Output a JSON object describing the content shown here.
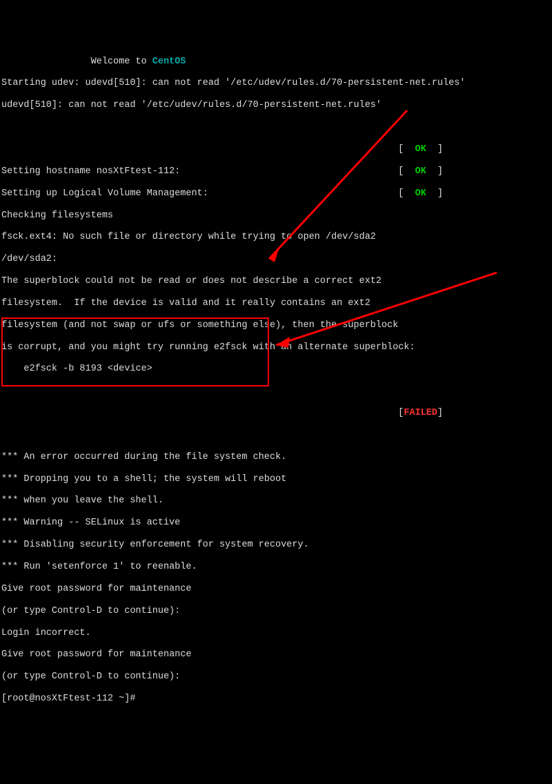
{
  "welcome_prefix": "                Welcome to ",
  "welcome_os": "CentOS",
  "boot": {
    "line1": "Starting udev: udevd[510]: can not read '/etc/udev/rules.d/70-persistent-net.rules'",
    "line2": "udevd[510]: can not read '/etc/udev/rules.d/70-persistent-net.rules'"
  },
  "status_rows": [
    {
      "label": "",
      "ok": "OK"
    },
    {
      "label": "Setting hostname nosXtFtest-112:",
      "ok": "OK"
    },
    {
      "label": "Setting up Logical Volume Management:",
      "ok": "OK"
    }
  ],
  "check_fs": "Checking filesystems",
  "fsck": {
    "l1": "fsck.ext4: No such file or directory while trying to open /dev/sda2",
    "l2": "/dev/sda2:",
    "l3": "The superblock could not be read or does not describe a correct ext2",
    "l4": "filesystem.  If the device is valid and it really contains an ext2",
    "l5": "filesystem (and not swap or ufs or something else), then the superblock",
    "l6": "is corrupt, and you might try running e2fsck with an alternate superblock:",
    "l7": "    e2fsck -b 8193 <device>"
  },
  "failed": "FAILED",
  "errors": {
    "e1": "*** An error occurred during the file system check.",
    "e2": "*** Dropping you to a shell; the system will reboot",
    "e3": "*** when you leave the shell.",
    "e4": "*** Warning -- SELinux is active",
    "e5": "*** Disabling security enforcement for system recovery.",
    "e6": "*** Run 'setenforce 1' to reenable."
  },
  "login": {
    "p1": "Give root password for maintenance",
    "p2": "(or type Control-D to continue):",
    "p3": "Login incorrect.",
    "p4": "Give root password for maintenance",
    "p5": "(or type Control-D to continue):",
    "prompt": "[root@nosXtFtest-112 ~]#"
  },
  "annotations": {
    "box_color": "#ff0000",
    "arrow_color": "#ff0000"
  }
}
